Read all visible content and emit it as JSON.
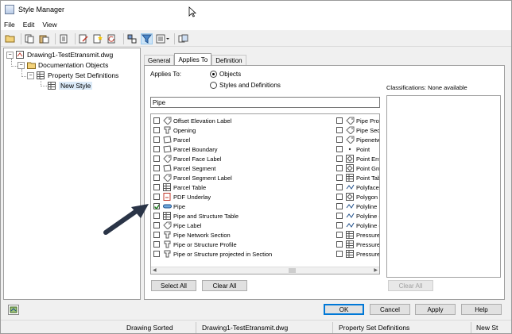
{
  "window": {
    "title": "Style Manager"
  },
  "menu": [
    "File",
    "Edit",
    "View"
  ],
  "toolbar": {
    "icons": [
      "open-icon",
      "copy-icon",
      "paste-icon",
      "purge-icon",
      "edit-style-icon",
      "new-style-icon",
      "refresh-icon",
      "filter-icon",
      "list-view-icon",
      "toggle-icon"
    ]
  },
  "tree": {
    "drawing": "Drawing1-TestEtransmit.dwg",
    "documentation": "Documentation Objects",
    "psd": "Property Set Definitions",
    "new_style": "New Style"
  },
  "tabs": [
    "General",
    "Applies To",
    "Definition"
  ],
  "applies_to": {
    "label": "Applies To:",
    "option_objects": "Objects",
    "option_styles": "Styles and Definitions",
    "filter_value": "Pipe",
    "classifications_label": "Classifications: None available"
  },
  "list_left": [
    {
      "label": "Offset Elevation Label",
      "checked": false
    },
    {
      "label": "Opening",
      "checked": false
    },
    {
      "label": "Parcel",
      "checked": false
    },
    {
      "label": "Parcel Boundary",
      "checked": false
    },
    {
      "label": "Parcel Face Label",
      "checked": false
    },
    {
      "label": "Parcel Segment",
      "checked": false
    },
    {
      "label": "Parcel Segment Label",
      "checked": false
    },
    {
      "label": "Parcel Table",
      "checked": false
    },
    {
      "label": "PDF Underlay",
      "checked": false
    },
    {
      "label": "Pipe",
      "checked": true
    },
    {
      "label": "Pipe and Structure Table",
      "checked": false
    },
    {
      "label": "Pipe Label",
      "checked": false
    },
    {
      "label": "Pipe Network Section",
      "checked": false
    },
    {
      "label": "Pipe or Structure Profile",
      "checked": false
    },
    {
      "label": "Pipe or Structure projected in Section",
      "checked": false
    }
  ],
  "list_right": [
    {
      "label": "Pipe Profi",
      "checked": false
    },
    {
      "label": "Pipe Sect",
      "checked": false
    },
    {
      "label": "Pipenetw",
      "checked": false
    },
    {
      "label": "Point",
      "checked": false
    },
    {
      "label": "Point Ent",
      "checked": false
    },
    {
      "label": "Point Gro",
      "checked": false
    },
    {
      "label": "Point Tab",
      "checked": false
    },
    {
      "label": "Polyface",
      "checked": false
    },
    {
      "label": "Polygon M",
      "checked": false
    },
    {
      "label": "Polyline",
      "checked": false
    },
    {
      "label": "Polyline (",
      "checked": false
    },
    {
      "label": "Polyline (",
      "checked": false
    },
    {
      "label": "Pressure",
      "checked": false
    },
    {
      "label": "Pressure",
      "checked": false
    },
    {
      "label": "Pressure",
      "checked": false
    }
  ],
  "buttons": {
    "select_all": "Select All",
    "clear_all": "Clear All",
    "clear_all_class": "Clear All",
    "ok": "OK",
    "cancel": "Cancel",
    "apply": "Apply",
    "help": "Help"
  },
  "status": {
    "cell1": "Drawing Sorted",
    "cell2": "Drawing1-TestEtransmit.dwg",
    "cell3": "Property Set Definitions",
    "cell4": "New St"
  }
}
